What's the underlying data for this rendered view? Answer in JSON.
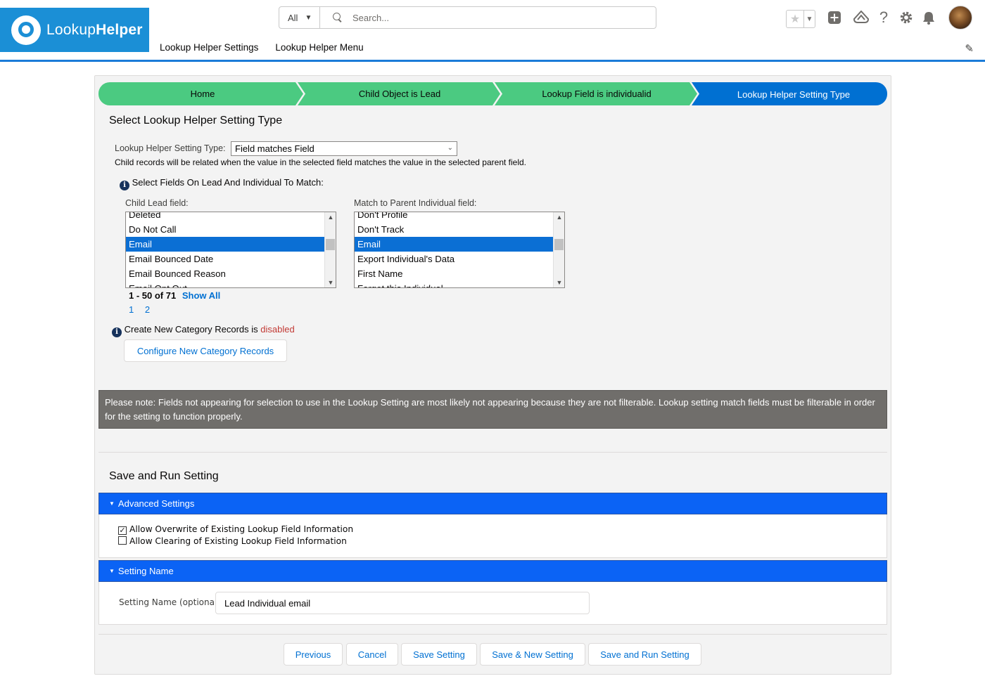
{
  "header": {
    "logo_text_light": "Lookup",
    "logo_text_bold": "Helper",
    "search_scope": "All",
    "search_placeholder": "Search...",
    "nav": [
      "Lookup Helper Settings",
      "Lookup Helper Menu"
    ]
  },
  "path": {
    "steps": [
      "Home",
      "Child Object is Lead",
      "Lookup Field is individualid",
      "Lookup Helper Setting Type"
    ],
    "current_index": 3
  },
  "type_section": {
    "title": "Select Lookup Helper Setting Type",
    "type_label": "Lookup Helper Setting Type:",
    "type_value": "Field matches Field",
    "type_description": "Child records will be related when the value in the selected field matches the value in the selected parent field.",
    "select_fields_label": "Select Fields On Lead And Individual To Match:",
    "child_field_label": "Child Lead field:",
    "parent_field_label": "Match to Parent Individual field:",
    "child_options": [
      "Deleted",
      "Do Not Call",
      "Email",
      "Email Bounced Date",
      "Email Bounced Reason",
      "Email Opt Out"
    ],
    "child_selected": "Email",
    "parent_options": [
      "Don't Profile",
      "Don't Track",
      "Email",
      "Export Individual's Data",
      "First Name",
      "Forget this Individual"
    ],
    "parent_selected": "Email",
    "pagination_text": "1 - 50 of 71",
    "show_all": "Show All",
    "pages": [
      "1",
      "2"
    ],
    "category_text": "Create New Category Records is",
    "category_status": "disabled",
    "configure_button": "Configure New Category Records"
  },
  "note": "Please note: Fields not appearing for selection to use in the Lookup Setting are most likely not appearing because they are not filterable. Lookup setting match fields must be filterable in order for the setting to function properly.",
  "save_section": {
    "title": "Save and Run Setting",
    "advanced_label": "Advanced Settings",
    "allow_overwrite": "Allow Overwrite of Existing Lookup Field Information",
    "allow_overwrite_checked": true,
    "allow_clearing": "Allow Clearing of Existing Lookup Field Information",
    "allow_clearing_checked": false,
    "setting_name_header": "Setting Name",
    "setting_name_label": "Setting Name (optional)",
    "setting_name_value": "Lead Individual email"
  },
  "buttons": {
    "previous": "Previous",
    "cancel": "Cancel",
    "save": "Save Setting",
    "save_new": "Save & New Setting",
    "save_run": "Save and Run Setting"
  },
  "colors": {
    "brand": "#1b8fd6",
    "path_done": "#4bca81",
    "path_current": "#0070d2",
    "section_bar": "#0b63f5",
    "disabled_text": "#c23934"
  }
}
